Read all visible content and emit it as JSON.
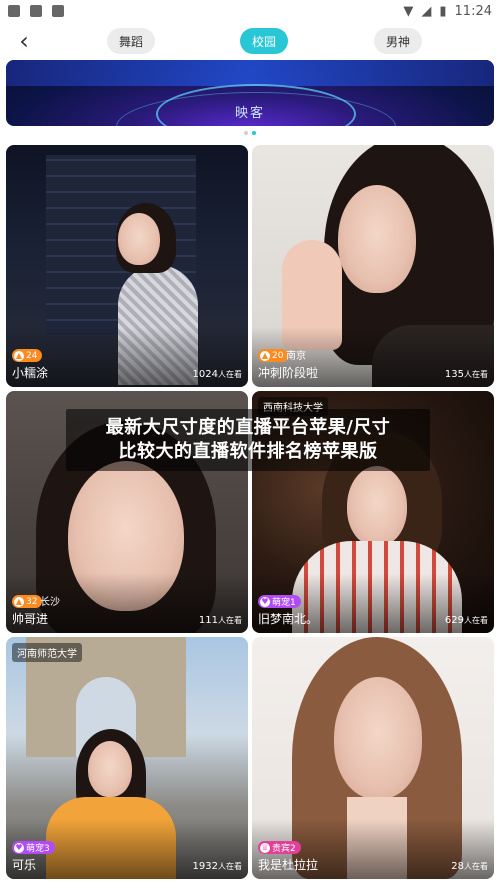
{
  "status_bar": {
    "time": "11:24"
  },
  "nav": {
    "tabs": [
      {
        "label": "舞蹈"
      },
      {
        "label": "校园"
      },
      {
        "label": "男神"
      }
    ],
    "active_tab": "校园"
  },
  "banner": {
    "subtitle": "映客"
  },
  "overlay": {
    "line1": "最新大尺寸度的直播平台苹果/尺寸",
    "line2": "比较大的直播软件排名榜苹果版"
  },
  "cards": [
    {
      "name": "小糯涂",
      "level": "24",
      "city": "",
      "school": "",
      "viewers": "1024",
      "viewers_unit": "人在看"
    },
    {
      "name": "冲刺阶段啦",
      "level": "20",
      "city": "南京",
      "school": "",
      "viewers": "135",
      "viewers_unit": "人在看"
    },
    {
      "name": "帅哥进",
      "level": "32",
      "city": "长沙",
      "school": "",
      "viewers": "111",
      "viewers_unit": "人在看"
    },
    {
      "name": "旧梦南北。",
      "level": "萌宠1",
      "city": "",
      "school": "西南科技大学",
      "viewers": "629",
      "viewers_unit": "人在看"
    },
    {
      "name": "可乐",
      "level": "萌宠3",
      "city": "",
      "school": "河南师范大学",
      "viewers": "1932",
      "viewers_unit": "人在看"
    },
    {
      "name": "我是杜拉拉",
      "level": "贵宾2",
      "city": "",
      "school": "",
      "viewers": "28",
      "viewers_unit": "人在看"
    }
  ]
}
